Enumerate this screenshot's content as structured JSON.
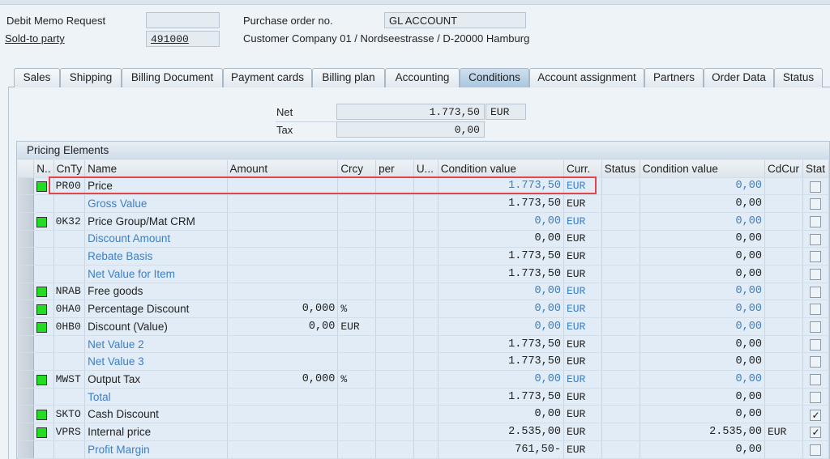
{
  "header": {
    "doc_type_label": "Debit Memo Request",
    "doc_number": "",
    "po_label": "Purchase order no.",
    "po_value": "GL ACCOUNT",
    "sold_to_label": "Sold-to party",
    "sold_to_value": "491000",
    "customer_text": "Customer Company 01 / Nordseestrasse / D-20000 Hamburg"
  },
  "tabs": [
    "Sales",
    "Shipping",
    "Billing Document",
    "Payment cards",
    "Billing plan",
    "Accounting",
    "Conditions",
    "Account assignment",
    "Partners",
    "Order Data",
    "Status"
  ],
  "active_tab": "Conditions",
  "totals": {
    "net_label": "Net",
    "net_value": "1.773,50",
    "net_currency": "EUR",
    "tax_label": "Tax",
    "tax_value": "0,00"
  },
  "grid": {
    "title": "Pricing Elements",
    "columns": [
      "N..",
      "CnTy",
      "Name",
      "Amount",
      "Crcy",
      "per",
      "U...",
      "Condition value",
      "Curr.",
      "Status",
      "Condition value",
      "CdCur",
      "Stat"
    ],
    "rows": [
      {
        "flag": true,
        "cnty": "PR00",
        "name": "Price",
        "subtotal": false,
        "amount": "",
        "crcy": "",
        "value": "1.773,50",
        "curr": "EUR",
        "value_blue": true,
        "cond_value2": "0,00",
        "cv2_blue": true,
        "cdcur": "",
        "stat": false
      },
      {
        "flag": false,
        "cnty": "",
        "name": "Gross Value",
        "subtotal": true,
        "amount": "",
        "crcy": "",
        "value": "1.773,50",
        "curr": "EUR",
        "value_blue": false,
        "cond_value2": "0,00",
        "cv2_blue": false,
        "cdcur": "",
        "stat": false
      },
      {
        "flag": true,
        "cnty": "0K32",
        "name": "Price Group/Mat CRM",
        "subtotal": false,
        "amount": "",
        "crcy": "",
        "value": "0,00",
        "curr": "EUR",
        "value_blue": true,
        "cond_value2": "0,00",
        "cv2_blue": true,
        "cdcur": "",
        "stat": false
      },
      {
        "flag": false,
        "cnty": "",
        "name": "Discount Amount",
        "subtotal": true,
        "amount": "",
        "crcy": "",
        "value": "0,00",
        "curr": "EUR",
        "value_blue": false,
        "cond_value2": "0,00",
        "cv2_blue": false,
        "cdcur": "",
        "stat": false
      },
      {
        "flag": false,
        "cnty": "",
        "name": "Rebate Basis",
        "subtotal": true,
        "amount": "",
        "crcy": "",
        "value": "1.773,50",
        "curr": "EUR",
        "value_blue": false,
        "cond_value2": "0,00",
        "cv2_blue": false,
        "cdcur": "",
        "stat": false
      },
      {
        "flag": false,
        "cnty": "",
        "name": "Net Value for Item",
        "subtotal": true,
        "amount": "",
        "crcy": "",
        "value": "1.773,50",
        "curr": "EUR",
        "value_blue": false,
        "cond_value2": "0,00",
        "cv2_blue": false,
        "cdcur": "",
        "stat": false
      },
      {
        "flag": true,
        "cnty": "NRAB",
        "name": "Free goods",
        "subtotal": false,
        "amount": "",
        "crcy": "",
        "value": "0,00",
        "curr": "EUR",
        "value_blue": true,
        "cond_value2": "0,00",
        "cv2_blue": true,
        "cdcur": "",
        "stat": false
      },
      {
        "flag": true,
        "cnty": "0HA0",
        "name": "Percentage Discount",
        "subtotal": false,
        "amount": "0,000",
        "crcy": "%",
        "value": "0,00",
        "curr": "EUR",
        "value_blue": true,
        "cond_value2": "0,00",
        "cv2_blue": true,
        "cdcur": "",
        "stat": false
      },
      {
        "flag": true,
        "cnty": "0HB0",
        "name": "Discount (Value)",
        "subtotal": false,
        "amount": "0,00",
        "crcy": "EUR",
        "value": "0,00",
        "curr": "EUR",
        "value_blue": true,
        "cond_value2": "0,00",
        "cv2_blue": true,
        "cdcur": "",
        "stat": false
      },
      {
        "flag": false,
        "cnty": "",
        "name": "Net Value 2",
        "subtotal": true,
        "amount": "",
        "crcy": "",
        "value": "1.773,50",
        "curr": "EUR",
        "value_blue": false,
        "cond_value2": "0,00",
        "cv2_blue": false,
        "cdcur": "",
        "stat": false
      },
      {
        "flag": false,
        "cnty": "",
        "name": "Net Value 3",
        "subtotal": true,
        "amount": "",
        "crcy": "",
        "value": "1.773,50",
        "curr": "EUR",
        "value_blue": false,
        "cond_value2": "0,00",
        "cv2_blue": false,
        "cdcur": "",
        "stat": false
      },
      {
        "flag": true,
        "cnty": "MWST",
        "name": "Output Tax",
        "subtotal": false,
        "amount": "0,000",
        "crcy": "%",
        "value": "0,00",
        "curr": "EUR",
        "value_blue": true,
        "cond_value2": "0,00",
        "cv2_blue": true,
        "cdcur": "",
        "stat": false
      },
      {
        "flag": false,
        "cnty": "",
        "name": "Total",
        "subtotal": true,
        "amount": "",
        "crcy": "",
        "value": "1.773,50",
        "curr": "EUR",
        "value_blue": false,
        "cond_value2": "0,00",
        "cv2_blue": false,
        "cdcur": "",
        "stat": false
      },
      {
        "flag": true,
        "cnty": "SKTO",
        "name": "Cash Discount",
        "subtotal": false,
        "amount": "",
        "crcy": "",
        "value": "0,00",
        "curr": "EUR",
        "value_blue": false,
        "cond_value2": "0,00",
        "cv2_blue": false,
        "cdcur": "",
        "stat": true
      },
      {
        "flag": true,
        "cnty": "VPRS",
        "name": "Internal price",
        "subtotal": false,
        "amount": "",
        "crcy": "",
        "value": "2.535,00",
        "curr": "EUR",
        "value_blue": false,
        "cond_value2": "2.535,00",
        "cv2_blue": false,
        "cdcur": "EUR",
        "stat": true
      },
      {
        "flag": false,
        "cnty": "",
        "name": "Profit Margin",
        "subtotal": true,
        "amount": "",
        "crcy": "",
        "value": "761,50-",
        "curr": "EUR",
        "value_blue": false,
        "cond_value2": "0,00",
        "cv2_blue": false,
        "cdcur": "",
        "stat": false
      }
    ]
  },
  "colors": {
    "accent_blue": "#3b7fc4",
    "highlight": "#e0474c",
    "status_green": "#22dd22"
  }
}
